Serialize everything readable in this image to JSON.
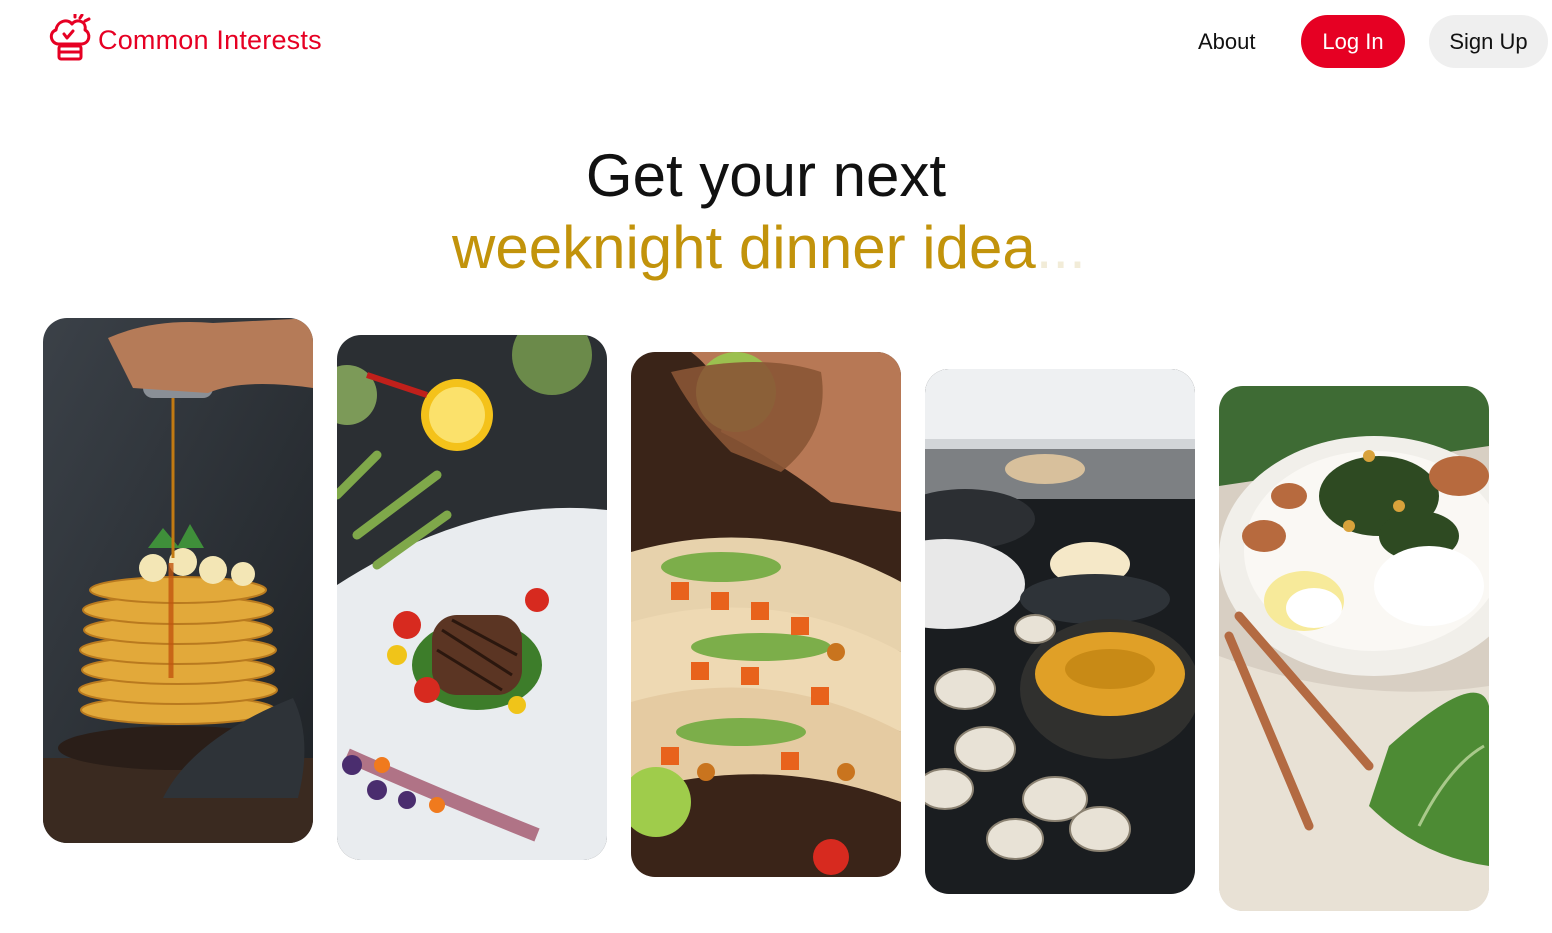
{
  "header": {
    "brand": "Common Interests",
    "nav": {
      "about": "About",
      "login": "Log In",
      "signup": "Sign Up"
    }
  },
  "hero": {
    "line1": "Get your next",
    "highlight": "weeknight dinner idea",
    "ellipsis": "..."
  },
  "colors": {
    "brand_red": "#e60023",
    "accent_gold": "#c2930b",
    "signup_bg": "#efefef"
  },
  "icons": {
    "logo": "chef-hat-icon"
  },
  "cards": [
    {
      "subject": "pancake stack with syrup"
    },
    {
      "subject": "grilled steak with vegetables"
    },
    {
      "subject": "chickpea tacos with lime"
    },
    {
      "subject": "clams and soup"
    },
    {
      "subject": "fish with potatoes and greens"
    }
  ]
}
